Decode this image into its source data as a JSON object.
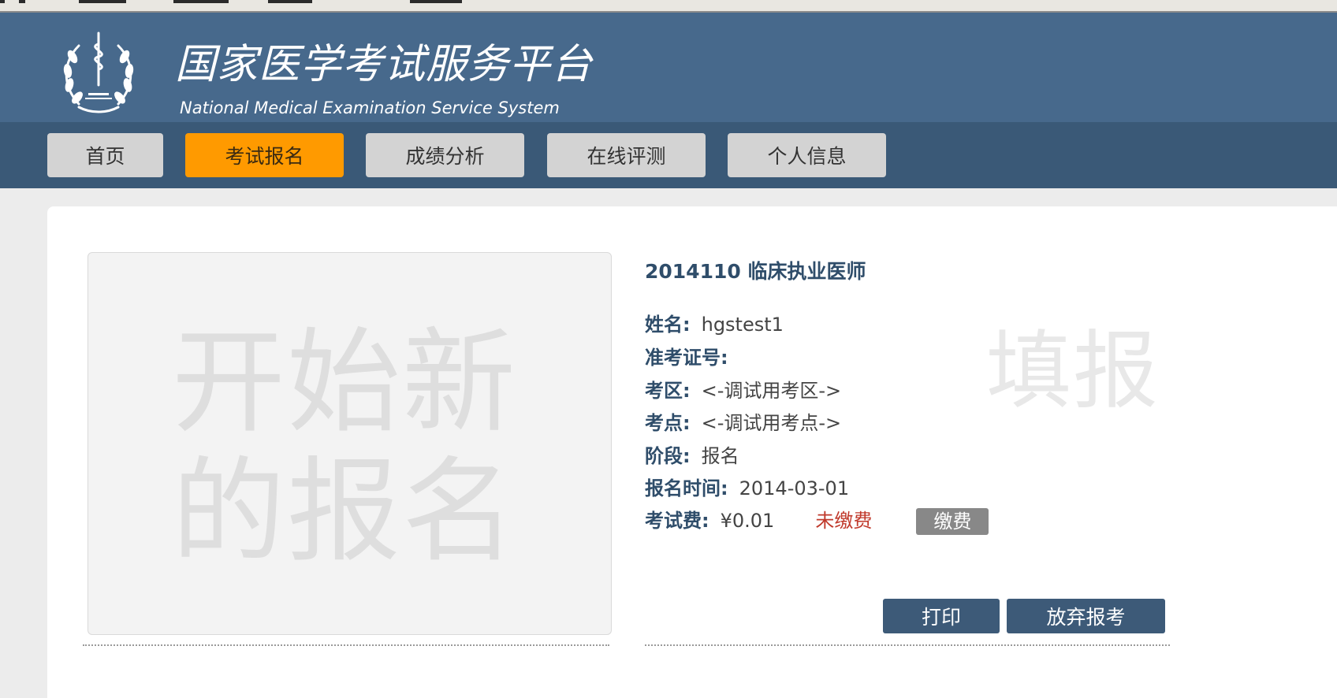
{
  "header": {
    "title": "国家医学考试服务平台",
    "subtitle": "National Medical Examination Service System"
  },
  "nav": {
    "items": [
      {
        "label": "首页",
        "active": false
      },
      {
        "label": "考试报名",
        "active": true
      },
      {
        "label": "成绩分析",
        "active": false
      },
      {
        "label": "在线评测",
        "active": false
      },
      {
        "label": "个人信息",
        "active": false
      }
    ]
  },
  "new_registration": {
    "label": "开始新的报名"
  },
  "registration": {
    "exam_title": "2014110 临床执业医师",
    "watermark": "填报",
    "name_label": "姓名:",
    "name_value": "hgstest1",
    "ticket_label": "准考证号:",
    "ticket_value": "",
    "area_label": "考区:",
    "area_value": "<-调试用考区->",
    "site_label": "考点:",
    "site_value": "<-调试用考点->",
    "stage_label": "阶段:",
    "stage_value": "报名",
    "time_label": "报名时间:",
    "time_value": "2014-03-01",
    "fee_label": "考试费:",
    "fee_value": "¥0.01",
    "fee_status": "未缴费",
    "pay_label": "缴费",
    "print_label": "打印",
    "abandon_label": "放弃报考"
  },
  "colors": {
    "header_bg": "#47698c",
    "nav_bg": "#3a5977",
    "accent": "#ff9a00",
    "unpaid": "#c0392b",
    "action_btn": "#3d5a78"
  }
}
